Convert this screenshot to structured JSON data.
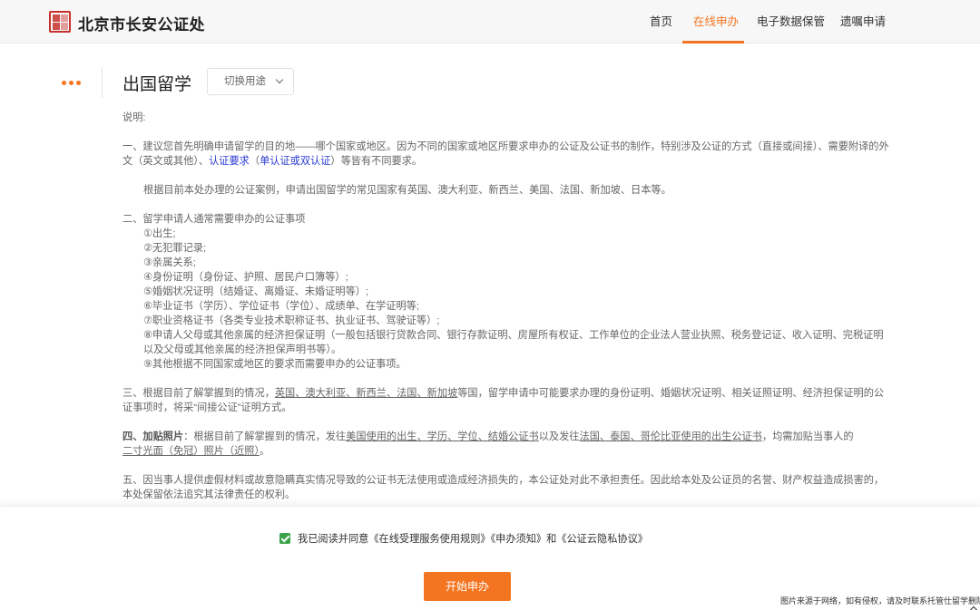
{
  "header": {
    "brand": "北京市长安公证处",
    "nav": [
      {
        "label": "首页",
        "active": false
      },
      {
        "label": "在线申办",
        "active": true
      },
      {
        "label": "电子数据保管",
        "active": false
      },
      {
        "label": "遗嘱申请",
        "active": false
      }
    ],
    "accent_color": "#f47521"
  },
  "page": {
    "title": "出国留学",
    "switch_label": "切换用途"
  },
  "content": {
    "intro": "说明:",
    "s1_a": "一、建议您首先明确申请留学的目的地——哪个国家或地区。因为不同的国家或地区所要求申办的公证及公证书的制作，特别涉及公证的方式（直接或间接）、需要附译的外文（英文或其他）、",
    "s1_req": "认证要求",
    "s1_paren_open": "（",
    "s1_req2": "单认证或双认证",
    "s1_paren_close": "）",
    "s1_b": "等皆有不同要求。",
    "s1_note": "根据目前本处办理的公证案例，申请出国留学的常见国家有英国、澳大利亚、新西兰、美国、法国、新加坡、日本等。",
    "s2_title": "二、留学申请人通常需要申办的公证事项",
    "s2_items": [
      "①出生;",
      "②无犯罪记录;",
      "③亲属关系;",
      "④身份证明（身份证、护照、居民户口簿等）;",
      "⑤婚姻状况证明（结婚证、离婚证、未婚证明等）;",
      "⑥毕业证书（学历）、学位证书（学位）、成绩单、在学证明等;",
      "⑦职业资格证书（各类专业技术职称证书、执业证书、驾驶证等）;",
      "⑧申请人父母或其他亲属的经济担保证明（一般包括银行贷款合同、银行存款证明、房屋所有权证、工作单位的企业法人营业执照、税务登记证、收入证明、完税证明以及父母或其他亲属的经济担保声明书等）。",
      "⑨其他根据不同国家或地区的要求而需要申办的公证事项。"
    ],
    "s3_a": "三、根据目前了解掌握到的情况，",
    "s3_ul": "英国、澳大利亚、新西兰、法国、新加坡",
    "s3_b": "等国，留学申请中可能要求办理的身份证明、婚姻状况证明、相关证照证明、经济担保证明的公证事项时，将采“间接公证”证明方式。",
    "s4_label": "四、加贴照片",
    "s4_a": "：根据目前了解掌握到的情况，发往",
    "s4_ul1": "美国使用的出生、学历、学位、结婚公证书",
    "s4_b": "以及发往",
    "s4_ul2": "法国、泰国、哥伦比亚使用的出生公证书",
    "s4_c": "，均需加贴当事人的",
    "s4_ul3": "二寸光面（免冠）照片（近照）",
    "s4_d": "。",
    "s5": "五、因当事人提供虚假材料或故意隐瞒真实情况导致的公证书无法使用或造成经济损失的，本公证处对此不承担责任。因此给本处及公证员的名誉、财产权益造成损害的，本处保留依法追究其法律责任的权利。"
  },
  "agreement": {
    "text": "我已阅读并同意《在线受理服务使用规则》《申办须知》和《公证云隐私协议》",
    "checked": true,
    "check_color": "#3aa24a"
  },
  "start_button": "开始申办",
  "watermark": "图片来源于网络，如有侵权，请及时联系托管仕留学删除"
}
